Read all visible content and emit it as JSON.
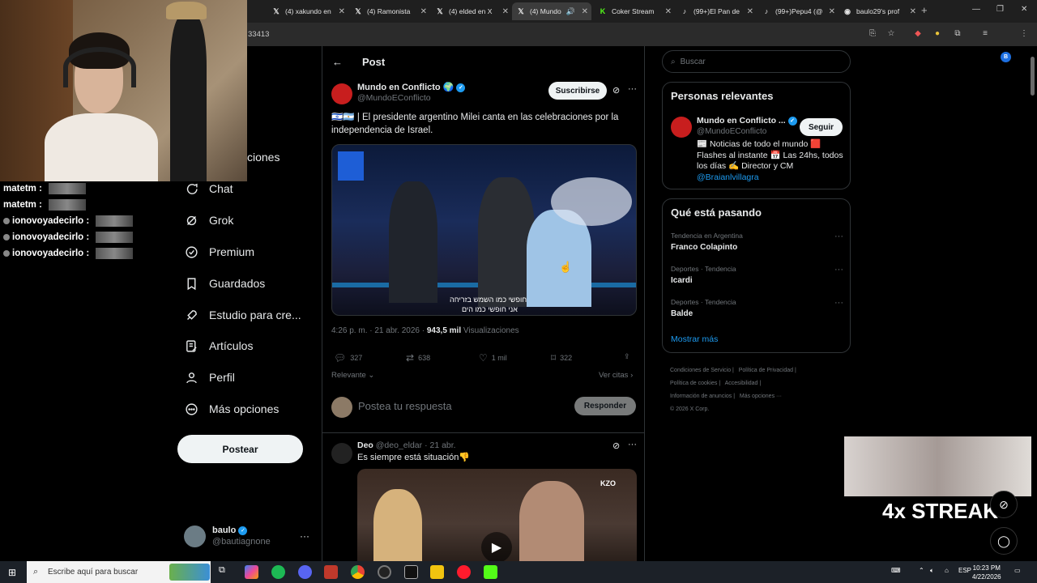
{
  "browser": {
    "tabs": [
      {
        "label": "(4) xakundo en",
        "icon": "x-icon"
      },
      {
        "label": "(4) Ramonista",
        "icon": "x-icon"
      },
      {
        "label": "(4) elded en X",
        "icon": "x-icon"
      },
      {
        "label": "(4) Mundo",
        "icon": "x-icon",
        "active": true
      },
      {
        "label": "Coker Stream",
        "icon": "kick-icon"
      },
      {
        "label": "(99+)El Pan de",
        "icon": "tiktok-icon"
      },
      {
        "label": "(99+)Pepu4 (@",
        "icon": "tiktok-icon"
      },
      {
        "label": "baulo29's prof",
        "icon": "globe-icon"
      }
    ],
    "address": "33413",
    "profile_initial": "B"
  },
  "chat": {
    "lines": [
      {
        "user": "matetm :"
      },
      {
        "user": "matetm :"
      },
      {
        "user": "ionovoyadecirlo :"
      },
      {
        "user": "ionovoyadecirlo :"
      },
      {
        "user": "ionovoyadecirlo :"
      }
    ]
  },
  "nav": {
    "partial_top": "r",
    "partial_notif": "ciones",
    "items": [
      {
        "label": "Chat",
        "icon": "chat-icon"
      },
      {
        "label": "Grok",
        "icon": "grok-icon"
      },
      {
        "label": "Premium",
        "icon": "premium-icon"
      },
      {
        "label": "Guardados",
        "icon": "bookmark-icon"
      },
      {
        "label": "Estudio para cre...",
        "icon": "rocket-icon"
      },
      {
        "label": "Artículos",
        "icon": "articles-icon"
      },
      {
        "label": "Perfil",
        "icon": "profile-icon"
      },
      {
        "label": "Más opciones",
        "icon": "more-circle-icon"
      }
    ],
    "post_button": "Postear",
    "account": {
      "name": "baulo",
      "handle": "@bautiagnone"
    }
  },
  "post": {
    "header": "Post",
    "author": {
      "name": "Mundo en Conflicto 🌍",
      "handle": "@MundoEConflicto"
    },
    "subscribe": "Suscribirse",
    "text": "🇮🇱🇦🇷 | El presidente argentino Milei canta en las celebraciones por la independencia de Israel.",
    "video_caption_1": "חופשי כמו השמש בזריחה",
    "video_caption_2": "אני חופשי כמו הים",
    "time": "4:26 p. m. · 21 abr. 2026 ·",
    "views_count": "943,5 mil",
    "views_label": "Visualizaciones",
    "replies": "327",
    "reposts": "638",
    "likes": "1 mil",
    "bookmarks": "322",
    "sort": "Relevante",
    "quotes": "Ver citas",
    "reply_placeholder": "Postea tu respuesta",
    "reply_button": "Responder"
  },
  "reply": {
    "name": "Deo",
    "handle": "@deo_eldar",
    "date": "· 21 abr.",
    "text": "Es siempre está situación👎",
    "watermark": "KZO"
  },
  "right": {
    "search_placeholder": "Buscar",
    "relevant": {
      "title": "Personas relevantes",
      "name": "Mundo en Conflicto ...",
      "handle": "@MundoEConflicto",
      "follow": "Seguir",
      "bio": "📰 Noticias de todo el mundo 🟥 Flashes al instante 📅 Las 24hs, todos los días ✍️ Director y CM",
      "bio_link": "@Braianlvillagra"
    },
    "trending": {
      "title": "Qué está pasando",
      "items": [
        {
          "context": "Tendencia en Argentina",
          "name": "Franco Colapinto"
        },
        {
          "context": "Deportes · Tendencia",
          "name": "Icardi"
        },
        {
          "context": "Deportes · Tendencia",
          "name": "Balde"
        }
      ],
      "show_more": "Mostrar más"
    },
    "footer": [
      "Condiciones de Servicio",
      "Política de Privacidad",
      "Política de cookies",
      "Accesibilidad",
      "Información de anuncios",
      "Más opciones ···",
      "© 2026 X Corp."
    ]
  },
  "overlay": {
    "streak": "4x STREAK"
  },
  "taskbar": {
    "search_placeholder": "Escribe aquí para buscar",
    "lang": "ESP",
    "time": "10:23 PM",
    "date": "4/22/2026"
  }
}
